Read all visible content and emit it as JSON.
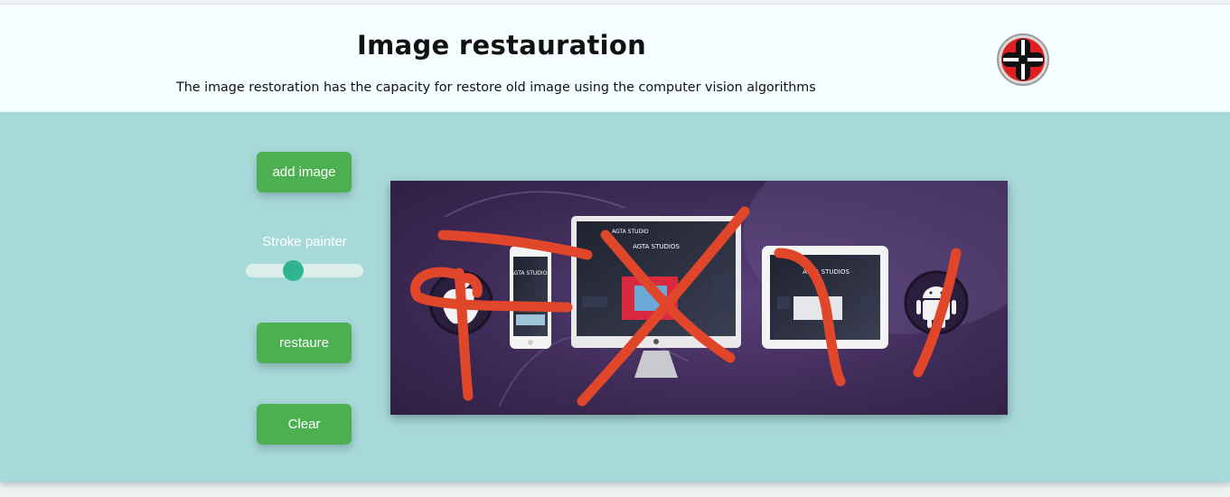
{
  "header": {
    "title": "Image restauration",
    "subtitle": "The image restoration has the capacity for restore old image using the computer vision algorithms",
    "logo_icon": "logo-emblem"
  },
  "controls": {
    "add_image_label": "add image",
    "stroke_label": "Stroke painter",
    "stroke_value": 0.38,
    "restore_label": "restaure",
    "clear_label": "Clear"
  },
  "canvas": {
    "image_texts": {
      "studio_name": "AGTA STUDIOS",
      "logo_text": "AGTA STUDIO"
    },
    "stroke_color": "#e0462a"
  },
  "colors": {
    "button": "#4caf50",
    "panel": "#a8d9da",
    "header": "#f5ffff",
    "slider_thumb": "#2fb48f"
  }
}
